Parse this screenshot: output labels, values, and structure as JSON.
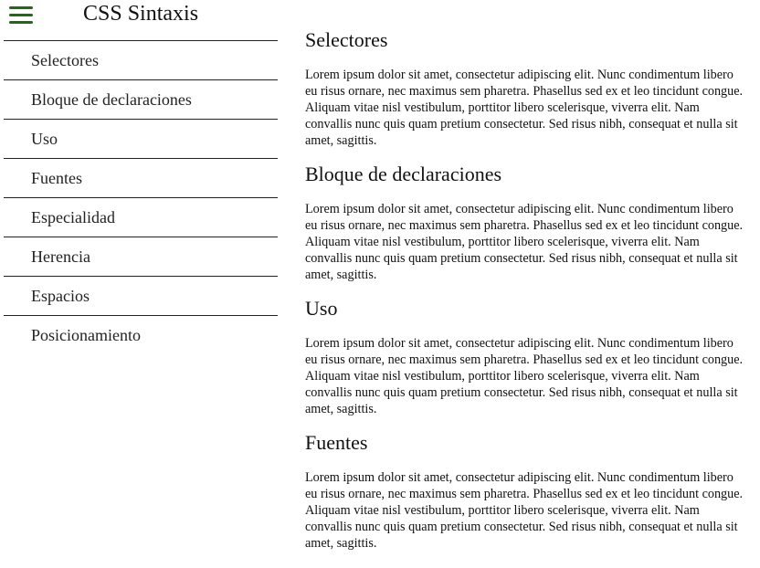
{
  "header": {
    "title": "CSS Sintaxis",
    "menu_icon": "hamburger-menu-icon",
    "accent_color": "#1f6b12"
  },
  "sidebar": {
    "items": [
      {
        "label": "Selectores"
      },
      {
        "label": "Bloque de declaraciones"
      },
      {
        "label": "Uso"
      },
      {
        "label": "Fuentes"
      },
      {
        "label": "Especialidad"
      },
      {
        "label": "Herencia"
      },
      {
        "label": "Espacios"
      },
      {
        "label": "Posicionamiento"
      }
    ]
  },
  "main": {
    "sections": [
      {
        "heading": "Selectores",
        "text": "Lorem ipsum dolor sit amet, consectetur adipiscing elit. Nunc condimentum libero eu risus ornare, nec maximus sem pharetra. Phasellus sed ex et leo tincidunt congue. Aliquam vitae nisl vestibulum, porttitor libero scelerisque, viverra elit. Nam convallis nunc quis quam pretium consectetur. Sed risus nibh, consequat et nulla sit amet, sagittis."
      },
      {
        "heading": "Bloque de declaraciones",
        "text": "Lorem ipsum dolor sit amet, consectetur adipiscing elit. Nunc condimentum libero eu risus ornare, nec maximus sem pharetra. Phasellus sed ex et leo tincidunt congue. Aliquam vitae nisl vestibulum, porttitor libero scelerisque, viverra elit. Nam convallis nunc quis quam pretium consectetur. Sed risus nibh, consequat et nulla sit amet, sagittis."
      },
      {
        "heading": "Uso",
        "text": "Lorem ipsum dolor sit amet, consectetur adipiscing elit. Nunc condimentum libero eu risus ornare, nec maximus sem pharetra. Phasellus sed ex et leo tincidunt congue. Aliquam vitae nisl vestibulum, porttitor libero scelerisque, viverra elit. Nam convallis nunc quis quam pretium consectetur. Sed risus nibh, consequat et nulla sit amet, sagittis."
      },
      {
        "heading": "Fuentes",
        "text": "Lorem ipsum dolor sit amet, consectetur adipiscing elit. Nunc condimentum libero eu risus ornare, nec maximus sem pharetra. Phasellus sed ex et leo tincidunt congue. Aliquam vitae nisl vestibulum, porttitor libero scelerisque, viverra elit. Nam convallis nunc quis quam pretium consectetur. Sed risus nibh, consequat et nulla sit amet, sagittis."
      }
    ]
  }
}
